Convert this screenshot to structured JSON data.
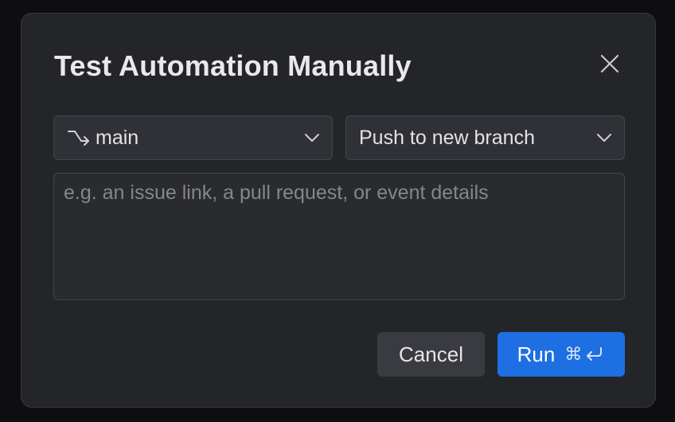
{
  "dialog": {
    "title": "Test Automation Manually",
    "branch_select": {
      "value": "main",
      "icon": "git-branch-icon"
    },
    "trigger_select": {
      "value": "Push to new branch"
    },
    "details_input": {
      "value": "",
      "placeholder": "e.g. an issue link, a pull request, or event details"
    },
    "cancel_label": "Cancel",
    "run_label": "Run",
    "run_shortcut": "⌘",
    "accent_color": "#1d6fe2"
  }
}
